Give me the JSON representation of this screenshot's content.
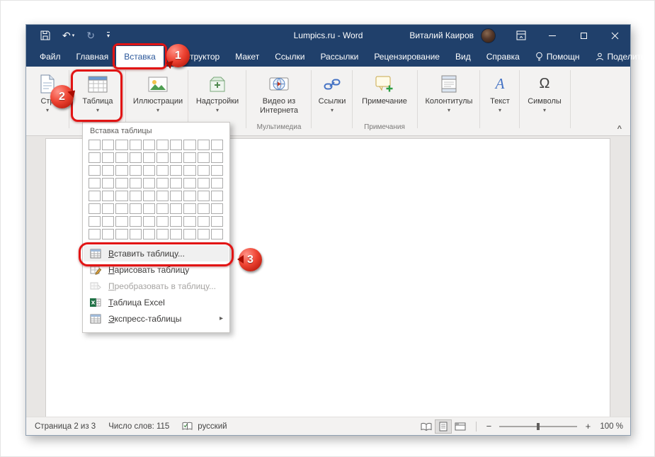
{
  "colors": {
    "titlebar_blue": "#20406b",
    "active_tab_blue": "#2b579a",
    "annotation_red": "#e21414",
    "excel_green": "#1e7145"
  },
  "titlebar": {
    "document_title": "Lumpics.ru - Word",
    "user_name": "Виталий Каиров"
  },
  "tabs": {
    "items": [
      {
        "label": "Файл"
      },
      {
        "label": "Главная"
      },
      {
        "label": "Вставка",
        "active": true
      },
      {
        "label": "Конструктор"
      },
      {
        "label": "Макет"
      },
      {
        "label": "Ссылки"
      },
      {
        "label": "Рассылки"
      },
      {
        "label": "Рецензирование"
      },
      {
        "label": "Вид"
      },
      {
        "label": "Справка"
      }
    ],
    "help_label": "Помощн",
    "share_label": "Поделиться"
  },
  "ribbon": {
    "buttons": [
      {
        "label": "Стр"
      },
      {
        "label": "Таблица"
      },
      {
        "label": "Иллюстрации"
      },
      {
        "label": "Надстройки"
      },
      {
        "label": "Видео из Интернета"
      },
      {
        "label": "Ссылки"
      },
      {
        "label": "Примечание"
      },
      {
        "label": "Колонтитулы"
      },
      {
        "label": "Текст"
      },
      {
        "label": "Символы"
      }
    ],
    "groups": {
      "multimedia": "Мультимедиа",
      "comments": "Примечания"
    }
  },
  "table_menu": {
    "title": "Вставка таблицы",
    "grid_rows": 8,
    "grid_cols": 10,
    "items": [
      {
        "label": "Вставить таблицу...",
        "state": "highlighted"
      },
      {
        "label": "Нарисовать таблицу",
        "state": "normal"
      },
      {
        "label": "Преобразовать в таблицу...",
        "state": "disabled"
      },
      {
        "label": "Таблица Excel",
        "state": "normal"
      },
      {
        "label": "Экспресс-таблицы",
        "state": "submenu"
      }
    ]
  },
  "status_bar": {
    "page_info": "Страница 2 из 3",
    "word_count": "Число слов: 115",
    "language": "русский",
    "zoom_value": "100 %"
  },
  "callouts": {
    "step1": "1",
    "step2": "2",
    "step3": "3"
  },
  "icons": {
    "caret_down": "▾",
    "submenu_arrow": "▸",
    "collapse_ribbon": "^",
    "undo": "↶",
    "redo": "↻",
    "zoom_minus": "−",
    "zoom_plus": "+",
    "text_button_glyph": "А",
    "symbols_button_glyph": "Ω"
  }
}
